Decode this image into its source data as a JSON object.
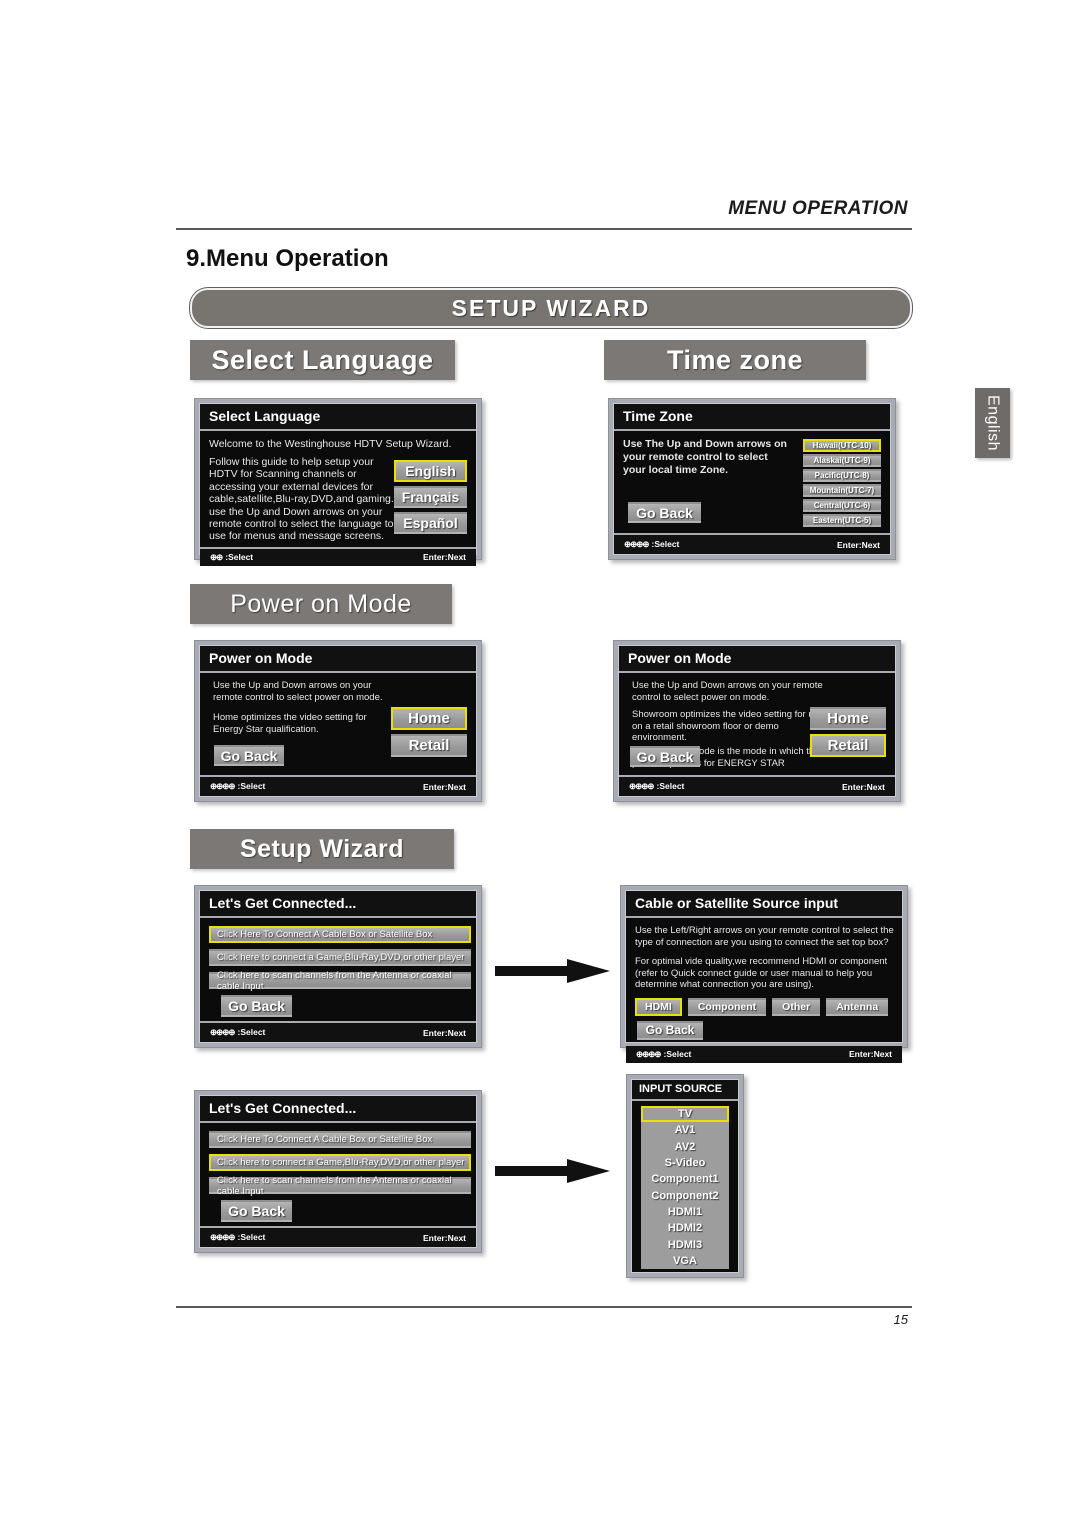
{
  "header": {
    "running_head": "MENU OPERATION",
    "section_number": "9.",
    "section_title": "Menu Operation",
    "wizard_banner": "SETUP  WIZARD",
    "side_tab": "English"
  },
  "banners": {
    "select_language": "Select  Language",
    "time_zone": "Time zone",
    "power_on_mode": "Power on Mode",
    "setup_wizard": "Setup Wizard"
  },
  "common": {
    "go_back": "Go Back",
    "enter_next": "Enter:Next",
    "select_2": ":Select",
    "select_4": ":Select",
    "dots_2": "⊕⊕",
    "dots_4": "⊕⊕⊕⊕"
  },
  "panels": {
    "select_language": {
      "title": "Select Language",
      "intro": "Welcome to the Westinghouse HDTV Setup Wizard.",
      "body": "Follow this guide to help setup your HDTV for Scanning channels or accessing your external devices for cable,satellite,Blu-ray,DVD,and gaming.\nuse the Up and Down arrows on your remote control to select the language to use for menus and message screens.",
      "options": [
        {
          "label": "English",
          "selected": true
        },
        {
          "label": "Français",
          "selected": false
        },
        {
          "label": "Español",
          "selected": false
        }
      ],
      "footer_left": ":Select",
      "footer_right": "Enter:Next"
    },
    "time_zone": {
      "title": "Time Zone",
      "body": "Use The Up and Down arrows on your remote control to select your local time Zone.",
      "go_back": "Go Back",
      "options": [
        {
          "label": "Hawaii(UTC-10)",
          "selected": true
        },
        {
          "label": "Alaskai(UTC-9)",
          "selected": false
        },
        {
          "label": "Pacific(UTC-8)",
          "selected": false
        },
        {
          "label": "Mountain(UTC-7)",
          "selected": false
        },
        {
          "label": "Central(UTC-6)",
          "selected": false
        },
        {
          "label": "Eastern(UTC-5)",
          "selected": false
        }
      ],
      "footer_left": ":Select",
      "footer_right": "Enter:Next"
    },
    "power_on_mode_home": {
      "title": "Power on Mode",
      "body1": "Use the Up and Down arrows on your remote control to select power on mode.",
      "body2": "Home optimizes the video setting for Energy Star qualification.",
      "go_back": "Go Back",
      "options": [
        {
          "label": "Home",
          "selected": true
        },
        {
          "label": "Retail",
          "selected": false
        }
      ],
      "footer_left": ":Select",
      "footer_right": "Enter:Next"
    },
    "power_on_mode_retail": {
      "title": "Power on Mode",
      "body1": "Use the Up and Down arrows on your remote control to select power on mode.",
      "body2": "Showroom optimizes the video setting for use on a retail showroom floor or demo environment.",
      "body3": "Home picture mode is the mode in which the product qualifies for ENERGY STAR",
      "go_back": "Go Back",
      "options": [
        {
          "label": "Home",
          "selected": false
        },
        {
          "label": "Retail",
          "selected": true
        }
      ],
      "footer_left": ":Select",
      "footer_right": "Enter:Next"
    },
    "lets_get_connected_1": {
      "title": "Let's Get Connected...",
      "options": [
        {
          "label": "Click Here To Connect A Cable Box or Satellite Box",
          "selected": true
        },
        {
          "label": "Click here to connect a Game,Blu-Ray,DVD,or other player",
          "selected": false
        },
        {
          "label": "Click here to scan channels from the Antenna or coaxial cable Input",
          "selected": false
        }
      ],
      "go_back": "Go Back",
      "footer_left": ":Select",
      "footer_right": "Enter:Next"
    },
    "lets_get_connected_2": {
      "title": "Let's Get Connected...",
      "options": [
        {
          "label": "Click Here To Connect A Cable Box or Satellite Box",
          "selected": false
        },
        {
          "label": "Click here to connect a Game,Blu-Ray,DVD,or other player",
          "selected": true
        },
        {
          "label": "Click here to scan channels from the Antenna or coaxial cable Input",
          "selected": false
        }
      ],
      "go_back": "Go Back",
      "footer_left": ":Select",
      "footer_right": "Enter:Next"
    },
    "cable_or_satellite": {
      "title": "Cable or Satellite Source input",
      "body1": "Use the Left/Right arrows on your remote control to select the type of connection are you using to connect the set top box?",
      "body2": "For optimal vide quality,we recommend HDMI or component (refer to Quick connect guide or user manual to help you determine what connection you are using).",
      "options": [
        {
          "label": "HDMI",
          "selected": true
        },
        {
          "label": "Component",
          "selected": false
        },
        {
          "label": "Other",
          "selected": false
        },
        {
          "label": "Antenna",
          "selected": false
        }
      ],
      "go_back": "Go Back",
      "footer_left": ":Select",
      "footer_right": "Enter:Next"
    },
    "input_source": {
      "title": "INPUT SOURCE",
      "options": [
        {
          "label": "TV",
          "selected": true
        },
        {
          "label": "AV1",
          "selected": false
        },
        {
          "label": "AV2",
          "selected": false
        },
        {
          "label": "S-Video",
          "selected": false
        },
        {
          "label": "Component1",
          "selected": false
        },
        {
          "label": "Component2",
          "selected": false
        },
        {
          "label": "HDMI1",
          "selected": false
        },
        {
          "label": "HDMI2",
          "selected": false
        },
        {
          "label": "HDMI3",
          "selected": false
        },
        {
          "label": "VGA",
          "selected": false
        }
      ]
    }
  },
  "footer": {
    "page_number": "15"
  },
  "colors": {
    "banner_grey": "#7b7875",
    "osd_frame": "#a8aab4",
    "osd_bg": "#0b0b0b",
    "button_grey": "#9d9d9d",
    "highlight_yellow": "#e8e000"
  }
}
